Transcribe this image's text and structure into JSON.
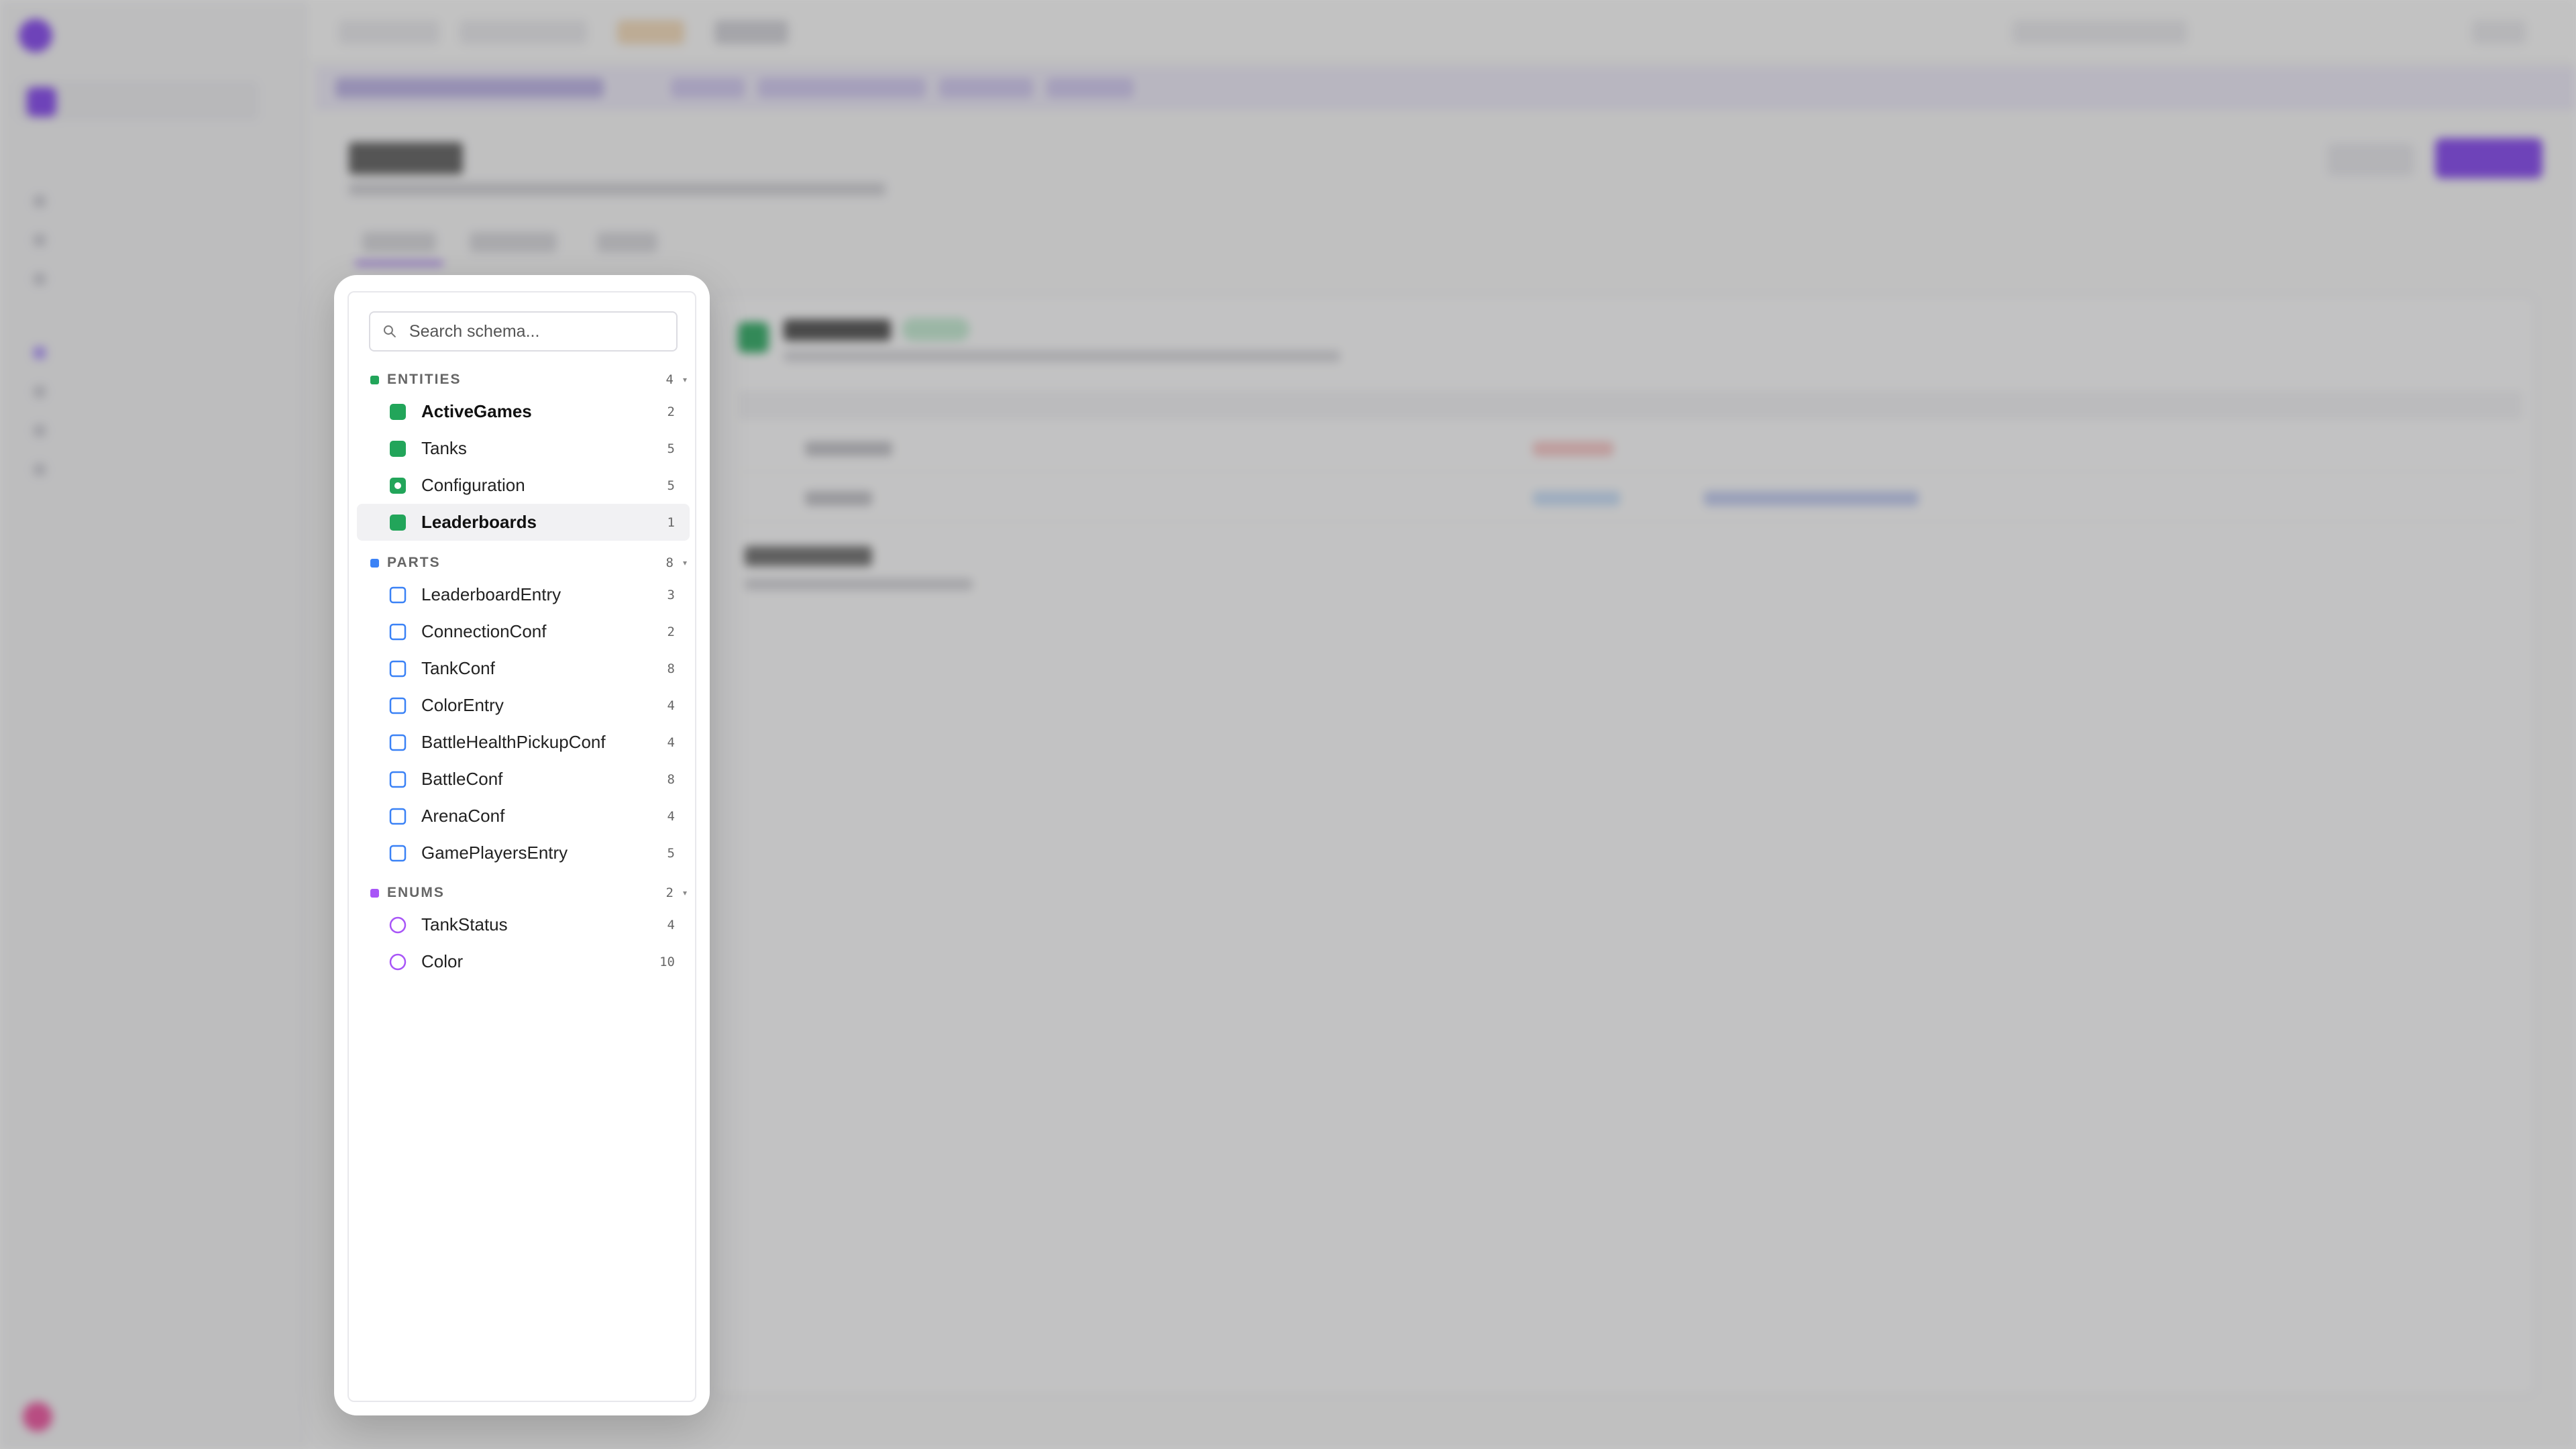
{
  "colors": {
    "entity": "#22a55a",
    "part": "#3b82f6",
    "enum": "#a855f7",
    "accent": "#7c3aed"
  },
  "schema": {
    "search": {
      "placeholder": "Search schema..."
    },
    "sections": {
      "entities": {
        "label": "ENTITIES",
        "count": "4",
        "items": [
          {
            "label": "ActiveGames",
            "count": "2",
            "icon": "entity-square-icon"
          },
          {
            "label": "Tanks",
            "count": "5",
            "icon": "entity-square-icon"
          },
          {
            "label": "Configuration",
            "count": "5",
            "icon": "entity-singleton-icon"
          },
          {
            "label": "Leaderboards",
            "count": "1",
            "icon": "entity-square-icon",
            "selected": true
          }
        ]
      },
      "parts": {
        "label": "PARTS",
        "count": "8",
        "items": [
          {
            "label": "LeaderboardEntry",
            "count": "3",
            "icon": "part-outline-icon"
          },
          {
            "label": "ConnectionConf",
            "count": "2",
            "icon": "part-outline-icon"
          },
          {
            "label": "TankConf",
            "count": "8",
            "icon": "part-outline-icon"
          },
          {
            "label": "ColorEntry",
            "count": "4",
            "icon": "part-outline-icon"
          },
          {
            "label": "BattleHealthPickupConf",
            "count": "4",
            "icon": "part-outline-icon"
          },
          {
            "label": "BattleConf",
            "count": "8",
            "icon": "part-outline-icon"
          },
          {
            "label": "ArenaConf",
            "count": "4",
            "icon": "part-outline-icon"
          },
          {
            "label": "GamePlayersEntry",
            "count": "5",
            "icon": "part-outline-icon"
          }
        ]
      },
      "enums": {
        "label": "ENUMS",
        "count": "2",
        "items": [
          {
            "label": "TankStatus",
            "count": "4",
            "icon": "enum-circle-icon"
          },
          {
            "label": "Color",
            "count": "10",
            "icon": "enum-circle-icon"
          }
        ]
      }
    }
  }
}
